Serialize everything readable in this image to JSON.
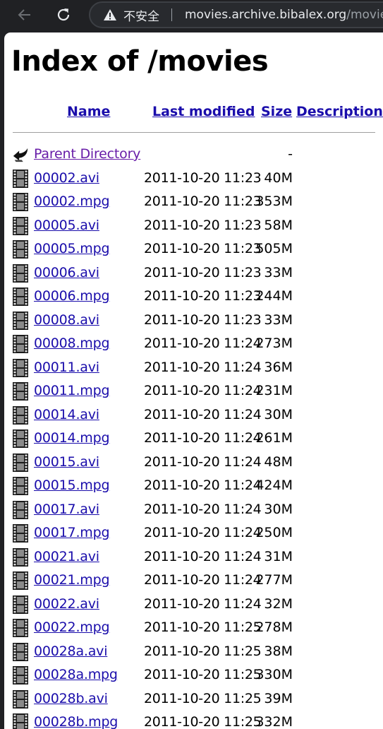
{
  "browser": {
    "security_label": "不安全",
    "url_host": "movies.archive.bibalex.org",
    "url_path": "/movies/"
  },
  "page": {
    "title": "Index of /movies",
    "columns": {
      "name": "Name",
      "last_modified": "Last modified",
      "size": "Size",
      "description": "Description"
    },
    "parent": {
      "name": "Parent Directory",
      "date": "",
      "size": "-"
    },
    "files": [
      {
        "name": "00002.avi",
        "date": "2011-10-20 11:23",
        "size": "40M"
      },
      {
        "name": "00002.mpg",
        "date": "2011-10-20 11:23",
        "size": "353M"
      },
      {
        "name": "00005.avi",
        "date": "2011-10-20 11:23",
        "size": "58M"
      },
      {
        "name": "00005.mpg",
        "date": "2011-10-20 11:23",
        "size": "505M"
      },
      {
        "name": "00006.avi",
        "date": "2011-10-20 11:23",
        "size": "33M"
      },
      {
        "name": "00006.mpg",
        "date": "2011-10-20 11:23",
        "size": "244M"
      },
      {
        "name": "00008.avi",
        "date": "2011-10-20 11:23",
        "size": "33M"
      },
      {
        "name": "00008.mpg",
        "date": "2011-10-20 11:24",
        "size": "273M"
      },
      {
        "name": "00011.avi",
        "date": "2011-10-20 11:24",
        "size": "36M"
      },
      {
        "name": "00011.mpg",
        "date": "2011-10-20 11:24",
        "size": "231M"
      },
      {
        "name": "00014.avi",
        "date": "2011-10-20 11:24",
        "size": "30M"
      },
      {
        "name": "00014.mpg",
        "date": "2011-10-20 11:24",
        "size": "261M"
      },
      {
        "name": "00015.avi",
        "date": "2011-10-20 11:24",
        "size": "48M"
      },
      {
        "name": "00015.mpg",
        "date": "2011-10-20 11:24",
        "size": "424M"
      },
      {
        "name": "00017.avi",
        "date": "2011-10-20 11:24",
        "size": "30M"
      },
      {
        "name": "00017.mpg",
        "date": "2011-10-20 11:24",
        "size": "250M"
      },
      {
        "name": "00021.avi",
        "date": "2011-10-20 11:24",
        "size": "31M"
      },
      {
        "name": "00021.mpg",
        "date": "2011-10-20 11:24",
        "size": "277M"
      },
      {
        "name": "00022.avi",
        "date": "2011-10-20 11:24",
        "size": "32M"
      },
      {
        "name": "00022.mpg",
        "date": "2011-10-20 11:25",
        "size": "278M"
      },
      {
        "name": "00028a.avi",
        "date": "2011-10-20 11:25",
        "size": "38M"
      },
      {
        "name": "00028a.mpg",
        "date": "2011-10-20 11:25",
        "size": "330M"
      },
      {
        "name": "00028b.avi",
        "date": "2011-10-20 11:25",
        "size": "39M"
      },
      {
        "name": "00028b.mpg",
        "date": "2011-10-20 11:25",
        "size": "332M"
      }
    ]
  },
  "icons": {
    "back": "back-arrow-icon",
    "reload": "reload-icon",
    "warning": "warning-icon",
    "parent": "parent-directory-icon",
    "file": "movie-file-icon"
  },
  "colors": {
    "link": "#1a0dab",
    "visited_link": "#681da8",
    "chrome_bg": "#202124"
  }
}
